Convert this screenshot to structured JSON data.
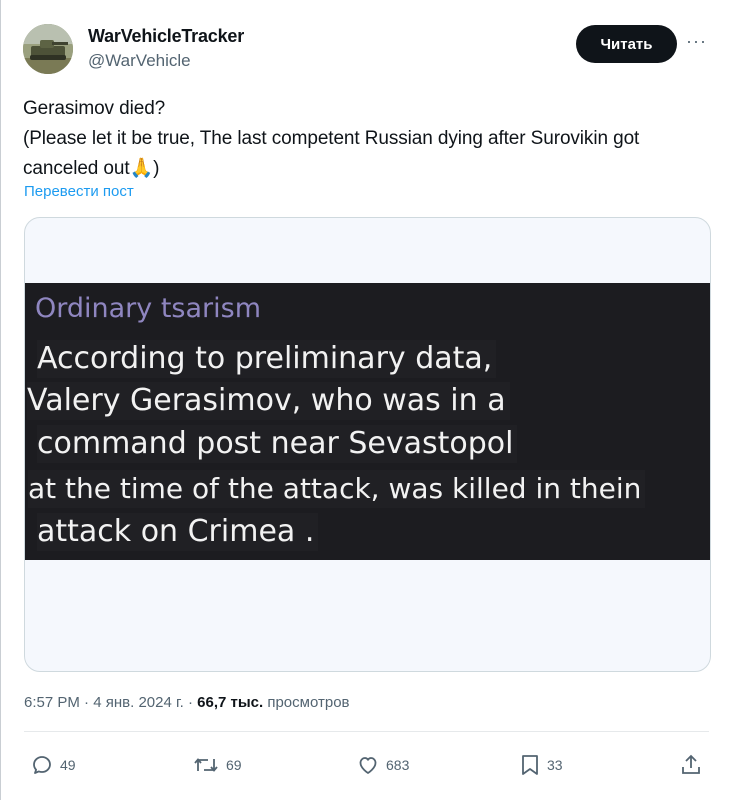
{
  "author": {
    "display_name": "WarVehicleTracker",
    "handle": "@WarVehicle",
    "avatar_icon": "tank-avatar"
  },
  "follow_button": {
    "label": "Читать"
  },
  "more_icon": "more-horizontal-icon",
  "post": {
    "text": "Gerasimov died?\n(Please let it be true, The last competent Russian dying after Surovikin got canceled out🙏)",
    "translate_label": "Перевести пост"
  },
  "media": {
    "header": "Ordinary tsarism",
    "lines": [
      "According to preliminary data,",
      "Valery Gerasimov, who was in a",
      "command post near Sevastopol",
      "at the time of the attack, was killed in thein",
      "attack on Crimea ."
    ]
  },
  "meta": {
    "time": "6:57 PM",
    "date": "4 янв. 2024 г.",
    "views_count": "66,7 тыс.",
    "views_label": "просмотров"
  },
  "actions": {
    "replies": "49",
    "reposts": "69",
    "likes": "683",
    "bookmarks": "33"
  },
  "colors": {
    "link": "#1d9bf0",
    "secondary_text": "#536471",
    "button_bg": "#0f1419",
    "media_header": "#8f86c0"
  }
}
